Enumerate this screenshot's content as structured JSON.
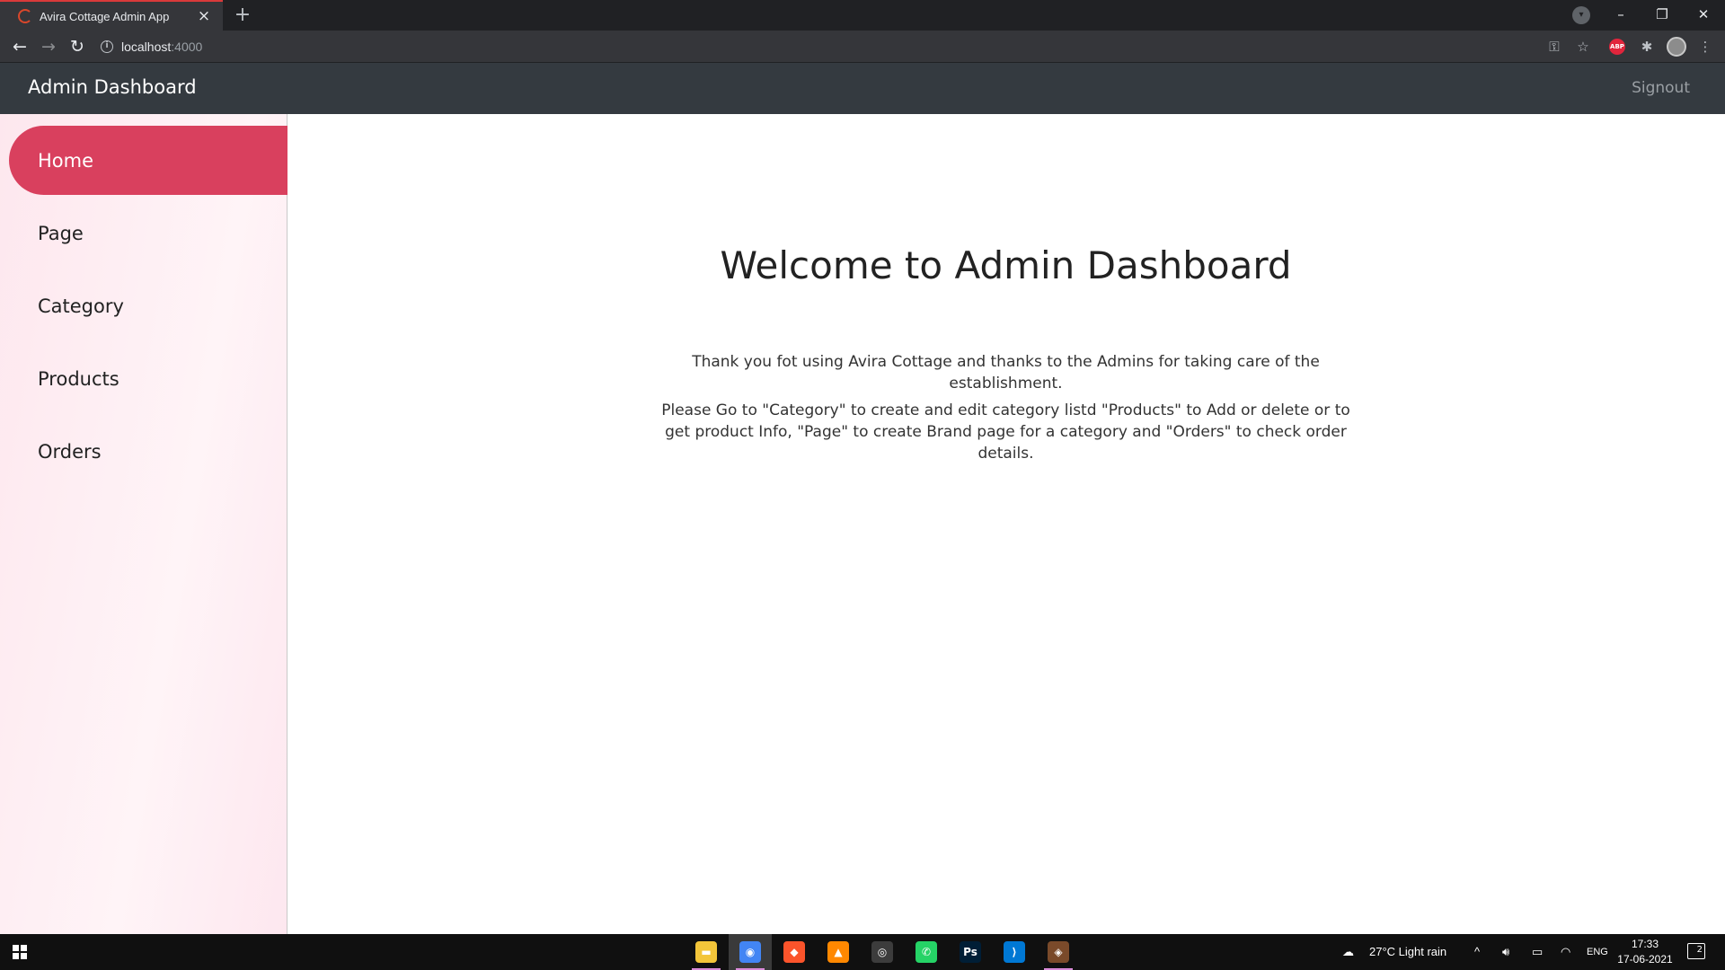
{
  "browser": {
    "tab_title": "Avira Cottage Admin App",
    "tab_close": "×",
    "new_tab": "+",
    "url_host": "localhost",
    "url_port": ":4000",
    "window_controls": {
      "minimize": "–",
      "restore": "❐",
      "close": "✕"
    },
    "extension_badge": "ABP"
  },
  "header": {
    "brand": "Admin Dashboard",
    "signout": "Signout"
  },
  "sidebar": {
    "items": [
      {
        "label": "Home",
        "active": true
      },
      {
        "label": "Page",
        "active": false
      },
      {
        "label": "Category",
        "active": false
      },
      {
        "label": "Products",
        "active": false
      },
      {
        "label": "Orders",
        "active": false
      }
    ]
  },
  "main": {
    "title": "Welcome to Admin Dashboard",
    "paragraph1": "Thank you fot using Avira Cottage and thanks to the Admins for taking care of the establishment.",
    "paragraph2": "Please Go to \"Category\" to create and edit category listd \"Products\" to Add or delete or to get product Info, \"Page\" to create Brand page for a category and \"Orders\" to check order details."
  },
  "taskbar": {
    "apps": [
      {
        "name": "file-explorer",
        "color": "#f3c53a",
        "glyph": "▬"
      },
      {
        "name": "chrome",
        "color": "#4285f4",
        "glyph": "◉"
      },
      {
        "name": "brave",
        "color": "#fb542b",
        "glyph": "◆"
      },
      {
        "name": "vlc",
        "color": "#ff8800",
        "glyph": "▲"
      },
      {
        "name": "obs",
        "color": "#3c3c3c",
        "glyph": "◎"
      },
      {
        "name": "whatsapp",
        "color": "#25d366",
        "glyph": "✆"
      },
      {
        "name": "photoshop",
        "color": "#001e36",
        "glyph": "Ps"
      },
      {
        "name": "vscode",
        "color": "#0078d4",
        "glyph": "⟩"
      },
      {
        "name": "git",
        "color": "#7a4a2a",
        "glyph": "◈"
      }
    ],
    "weather": "27°C  Light rain",
    "language": "ENG",
    "time": "17:33",
    "date": "17-06-2021",
    "notification_count": "2"
  },
  "colors": {
    "accent": "#d9405e",
    "header_bg": "#343a40",
    "sidebar_bg": "#fde7ee"
  }
}
